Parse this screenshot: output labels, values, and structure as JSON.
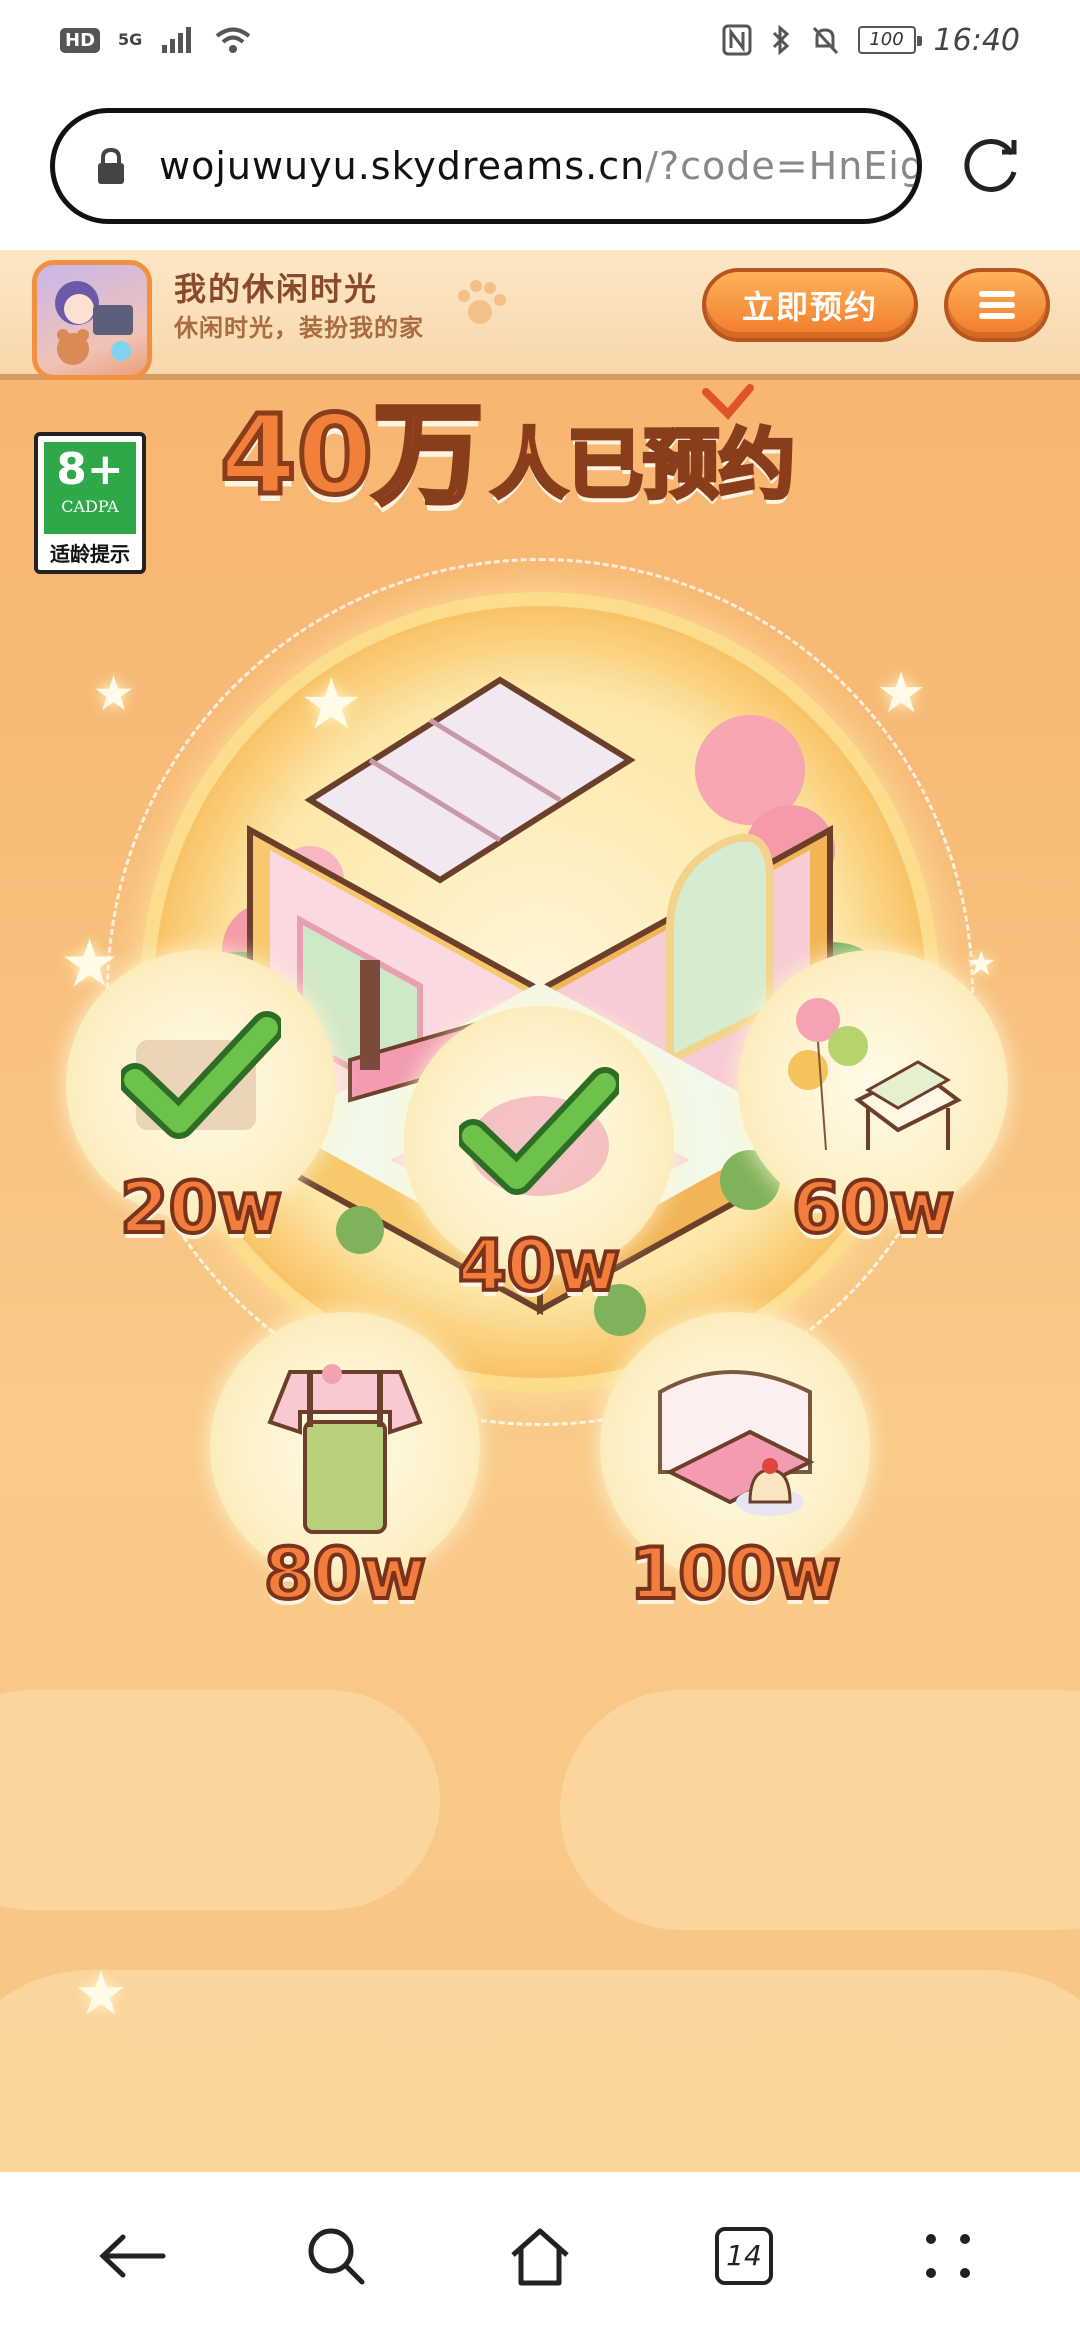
{
  "status_bar": {
    "hd": "HD",
    "network": "5G",
    "battery": "100",
    "time": "16:40"
  },
  "browser": {
    "url_host": "wojuwuyu.skydreams.cn",
    "url_path": "/?code=HnEigUcl",
    "tab_count": "14"
  },
  "header": {
    "app_title": "我的休闲时光",
    "app_subtitle": "休闲时光，装扮我的家",
    "reserve_button": "立即预约"
  },
  "age_rating": {
    "age": "8+",
    "org": "CADPA",
    "label": "适龄提示"
  },
  "counter": {
    "number": "40万",
    "text": "人已预约"
  },
  "rewards": [
    {
      "label": "20w",
      "unlocked": true,
      "icon": "reward-20w-icon"
    },
    {
      "label": "40w",
      "unlocked": true,
      "icon": "reward-40w-icon"
    },
    {
      "label": "60w",
      "unlocked": false,
      "icon": "balloon-chair-icon"
    },
    {
      "label": "80w",
      "unlocked": false,
      "icon": "overalls-icon"
    },
    {
      "label": "100w",
      "unlocked": false,
      "icon": "bed-pudding-icon"
    }
  ],
  "colors": {
    "accent": "#f07c2a",
    "page_bg": "#f8b470",
    "check_green": "#4cae3a"
  }
}
